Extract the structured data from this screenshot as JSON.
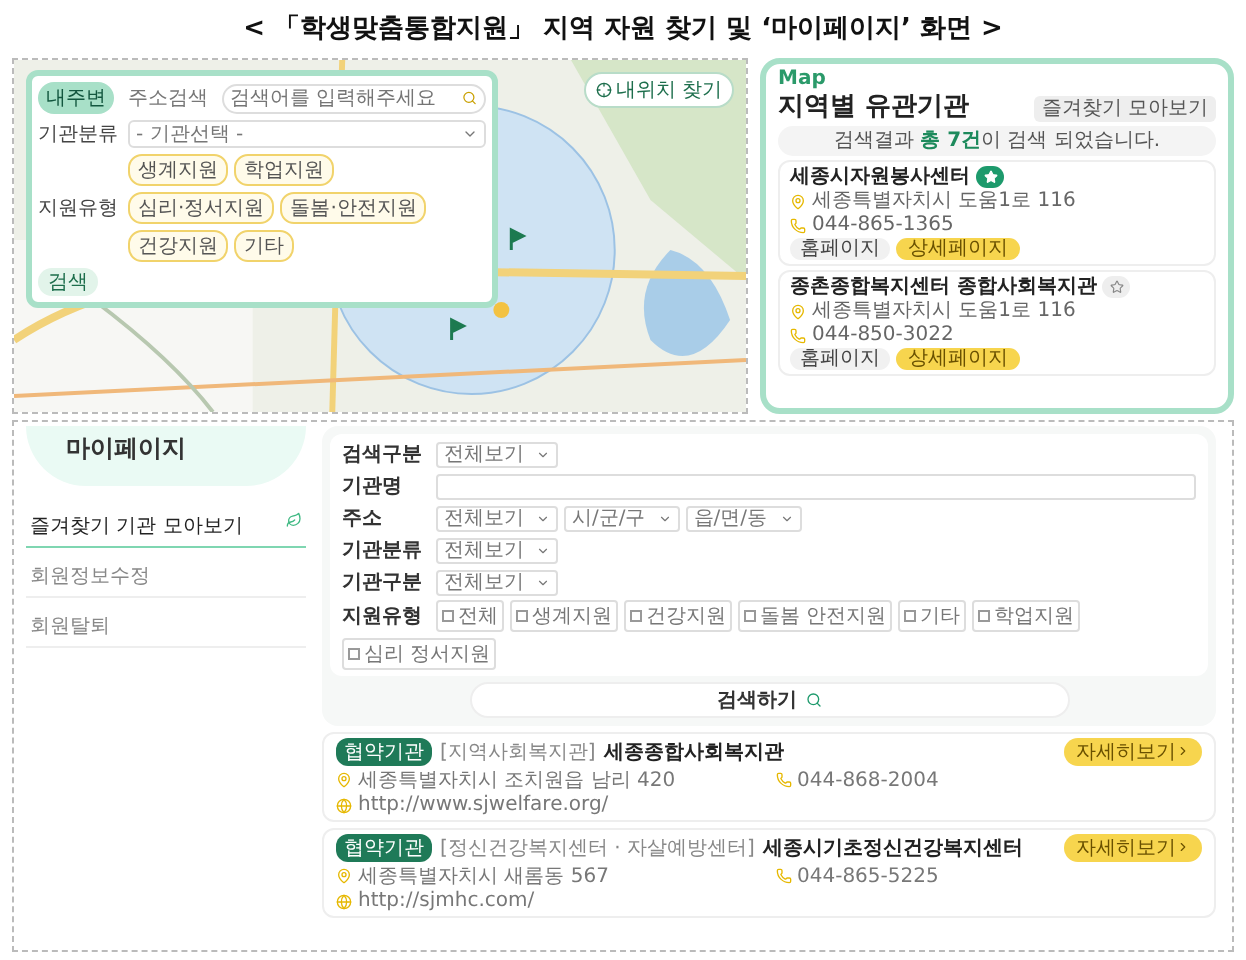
{
  "caption": "< 「학생맞춤통합지원」 지역 자원 찾기 및 ‘마이페이지’ 화면 >",
  "map_screen": {
    "tabs": [
      {
        "label": "내주변",
        "selected": true
      },
      {
        "label": "주소검색",
        "selected": false
      }
    ],
    "search_placeholder": "검색어를 입력해주세요",
    "category_label": "기관분류",
    "category_value": "- 기관선택 -",
    "support_label": "지원유형",
    "support_chips": [
      "생계지원",
      "학업지원",
      "심리·정서지원",
      "돌봄·안전지원",
      "건강지원",
      "기타"
    ],
    "search_button": "검색",
    "location_button": "내위치 찾기"
  },
  "org_panel": {
    "badge": "Map",
    "title": "지역별 유관기관",
    "favorites_button": "즐겨찾기 모아보기",
    "result_text": "검색결과 **총 7건**이 검색 되었습니다.",
    "cards": [
      {
        "name": "세종시자원봉사센터",
        "favorite": true,
        "address": "세종특별자치시 도움1로 116",
        "phone": "044-865-1365",
        "home_button": "홈페이지",
        "detail_button": "상세페이지"
      },
      {
        "name": "종촌종합복지센터 종합사회복지관",
        "favorite": false,
        "address": "세종특별자치시 도움1로 116",
        "phone": "044-850-3022",
        "home_button": "홈페이지",
        "detail_button": "상세페이지"
      }
    ]
  },
  "mypage": {
    "title": "마이페이지",
    "menu": [
      {
        "label": "즐겨찾기 기관 모아보기",
        "selected": true
      },
      {
        "label": "회원정보수정",
        "selected": false
      },
      {
        "label": "회원탈퇴",
        "selected": false
      }
    ],
    "form_rows": [
      {
        "label": "검색구분",
        "kind": "select",
        "values": [
          "전체보기"
        ]
      },
      {
        "label": "기관명",
        "kind": "text"
      },
      {
        "label": "주소",
        "kind": "select",
        "values": [
          "전체보기",
          "시/군/구",
          "읍/면/동"
        ]
      },
      {
        "label": "기관분류",
        "kind": "select",
        "values": [
          "전체보기"
        ]
      },
      {
        "label": "기관구분",
        "kind": "select",
        "values": [
          "전체보기"
        ]
      },
      {
        "label": "지원유형",
        "kind": "checks",
        "values": [
          {
            "label": "전체",
            "checked": false
          },
          {
            "label": "생계지원",
            "checked": false
          },
          {
            "label": "건강지원",
            "checked": false
          },
          {
            "label": "돌봄 안전지원",
            "checked": false
          },
          {
            "label": "기타",
            "checked": false
          },
          {
            "label": "학업지원",
            "checked": false
          },
          {
            "label": "심리 정서지원",
            "checked": false
          }
        ]
      }
    ],
    "search_button": "검색하기",
    "results": [
      {
        "badge": "협약기관",
        "category": "[지역사회복지관]",
        "name": "세종종합사회복지관",
        "address": "세종특별자치시 조치원읍 남리 420",
        "url": "http://www.sjwelfare.org/",
        "phone": "044-868-2004",
        "detail_button": "자세히보기"
      },
      {
        "badge": "협약기관",
        "category": "[정신건강복지센터 · 자살예방센터]",
        "name": "세종시기초정신건강복지센터",
        "address": "세종특별자치시 새롬동 567",
        "url": "http://sjmhc.com/",
        "phone": "044-865-5225",
        "detail_button": "자세히보기"
      }
    ]
  }
}
